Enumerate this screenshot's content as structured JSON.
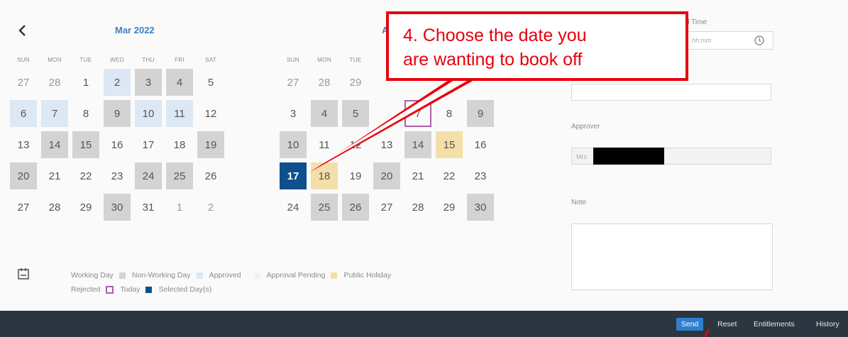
{
  "calendar": {
    "weekdays": [
      "SUN",
      "MON",
      "TUE",
      "WED",
      "THU",
      "FRI",
      "SAT"
    ],
    "months": [
      {
        "title": "Mar 2022",
        "weekdays": [
          "SUN",
          "MON",
          "TUE",
          "WED",
          "THU",
          "FRI",
          "SAT"
        ],
        "rows": [
          [
            {
              "d": "27",
              "s": "out"
            },
            {
              "d": "28",
              "s": "out"
            },
            {
              "d": "1",
              "s": "wd"
            },
            {
              "d": "2",
              "s": "ap"
            },
            {
              "d": "3",
              "s": "nw"
            },
            {
              "d": "4",
              "s": "nw"
            },
            {
              "d": "5",
              "s": "wd"
            }
          ],
          [
            {
              "d": "6",
              "s": "ap"
            },
            {
              "d": "7",
              "s": "ap"
            },
            {
              "d": "8",
              "s": "wd"
            },
            {
              "d": "9",
              "s": "nw"
            },
            {
              "d": "10",
              "s": "ap"
            },
            {
              "d": "11",
              "s": "ap"
            },
            {
              "d": "12",
              "s": "wd"
            }
          ],
          [
            {
              "d": "13",
              "s": "wd"
            },
            {
              "d": "14",
              "s": "nw"
            },
            {
              "d": "15",
              "s": "nw"
            },
            {
              "d": "16",
              "s": "wd"
            },
            {
              "d": "17",
              "s": "wd"
            },
            {
              "d": "18",
              "s": "wd"
            },
            {
              "d": "19",
              "s": "nw"
            }
          ],
          [
            {
              "d": "20",
              "s": "nw"
            },
            {
              "d": "21",
              "s": "wd"
            },
            {
              "d": "22",
              "s": "wd"
            },
            {
              "d": "23",
              "s": "wd"
            },
            {
              "d": "24",
              "s": "nw"
            },
            {
              "d": "25",
              "s": "nw"
            },
            {
              "d": "26",
              "s": "wd"
            }
          ],
          [
            {
              "d": "27",
              "s": "wd"
            },
            {
              "d": "28",
              "s": "wd"
            },
            {
              "d": "29",
              "s": "wd"
            },
            {
              "d": "30",
              "s": "nw"
            },
            {
              "d": "31",
              "s": "wd"
            },
            {
              "d": "1",
              "s": "out"
            },
            {
              "d": "2",
              "s": "out"
            }
          ]
        ]
      },
      {
        "title": "A",
        "weekdays": [
          "SUN",
          "MON",
          "TUE",
          "",
          "",
          "",
          ""
        ],
        "rows": [
          [
            {
              "d": "27",
              "s": "out"
            },
            {
              "d": "28",
              "s": "out"
            },
            {
              "d": "29",
              "s": "out"
            },
            {
              "d": "",
              "s": "wd"
            },
            {
              "d": "",
              "s": "wd"
            },
            {
              "d": "",
              "s": "wd"
            },
            {
              "d": "",
              "s": "wd"
            }
          ],
          [
            {
              "d": "3",
              "s": "wd"
            },
            {
              "d": "4",
              "s": "nw"
            },
            {
              "d": "5",
              "s": "nw"
            },
            {
              "d": "",
              "s": "wd"
            },
            {
              "d": "7",
              "s": "today"
            },
            {
              "d": "8",
              "s": "wd"
            },
            {
              "d": "9",
              "s": "nw"
            }
          ],
          [
            {
              "d": "10",
              "s": "nw"
            },
            {
              "d": "11",
              "s": "wd"
            },
            {
              "d": "12",
              "s": "wd"
            },
            {
              "d": "13",
              "s": "wd"
            },
            {
              "d": "14",
              "s": "nw"
            },
            {
              "d": "15",
              "s": "ph"
            },
            {
              "d": "16",
              "s": "wd"
            }
          ],
          [
            {
              "d": "17",
              "s": "sel"
            },
            {
              "d": "18",
              "s": "ph"
            },
            {
              "d": "19",
              "s": "wd"
            },
            {
              "d": "20",
              "s": "nw"
            },
            {
              "d": "21",
              "s": "wd"
            },
            {
              "d": "22",
              "s": "wd"
            },
            {
              "d": "23",
              "s": "wd"
            }
          ],
          [
            {
              "d": "24",
              "s": "wd"
            },
            {
              "d": "25",
              "s": "nw"
            },
            {
              "d": "26",
              "s": "nw"
            },
            {
              "d": "27",
              "s": "wd"
            },
            {
              "d": "28",
              "s": "wd"
            },
            {
              "d": "29",
              "s": "wd"
            },
            {
              "d": "30",
              "s": "nw"
            }
          ]
        ]
      }
    ]
  },
  "form": {
    "end_time_label": "d Time",
    "end_time_placeholder": "hh:mm",
    "approver_label": "Approver",
    "approver_value": "Mrs",
    "note_label": "Note"
  },
  "legend": {
    "row1": [
      "Working Day",
      "Non-Working Day",
      "Approved",
      "Approval Pending",
      "Public Holiday"
    ],
    "row2": [
      "Rejected",
      "Today",
      "Selected Day(s)"
    ]
  },
  "callout": {
    "line1": "4. Choose the date you",
    "line2": "are wanting to book off"
  },
  "toolbar": {
    "send": "Send",
    "reset": "Reset",
    "entitlements": "Entitlements",
    "history": "History"
  },
  "colors": {
    "selected": "#0e4f8e",
    "approved": "#dce8f3",
    "non_working": "#d3d3d3",
    "public_holiday": "#f5dfa8",
    "today_border": "#b05ea8",
    "callout_red": "#e8000d",
    "toolbar_bg": "#2c3640",
    "send_button": "#2f7fcf"
  },
  "icons": {
    "back": "chevron-left-icon",
    "legend_toggle": "calendar-icon",
    "time": "clock-icon"
  }
}
